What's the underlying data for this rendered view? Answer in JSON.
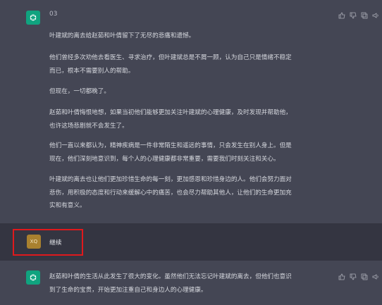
{
  "first_response": {
    "round_label": "03",
    "paragraphs": [
      "叶建斌的离去给赵茹和叶倩留下了无尽的悲痛和遗憾。",
      "他们曾经多次劝他去看医生、寻求治疗，但叶建斌总是不屑一顾，认为自己只是情绪不稳定",
      "而已，根本不需要别人的帮助。",
      "但现在，一切都晚了。",
      "赵茹和叶倩悔恨地想，如果当初他们能够更加关注叶建斌的心理健康，及时发现并帮助他，",
      "也许这场悲剧就不会发生了。",
      "他们一直以来都认为，精神疾病是一件非常陌生和遥远的事情，只会发生在别人身上。但是",
      "现在，他们深刻地意识到，每个人的心理健康都非常重要，需要我们时刻关注和关心。",
      "叶建斌的离去也让他们更加珍惜生命的每一刻，更加感恩和珍惜身边的人。他们会努力面对",
      "悲伤，用积极的态度和行动来缓解心中的痛苦，也会尽力帮助其他人，让他们的生命更加充",
      "实和有意义。"
    ]
  },
  "user_message": {
    "avatar_initials": "XQ",
    "text": "继续"
  },
  "second_response": {
    "paragraphs": [
      "赵茹和叶倩的生活从此发生了很大的变化。虽然他们无法忘记叶建斌的离去，但他们也意识",
      "到了生命的宝贵，开始更加注重自己和身边人的心理健康。"
    ]
  },
  "colors": {
    "assistant_bg": "#444654",
    "user_bg": "#343541",
    "gpt_avatar": "#10a37f",
    "user_avatar": "#a9812f",
    "highlight": "#e0191c"
  }
}
